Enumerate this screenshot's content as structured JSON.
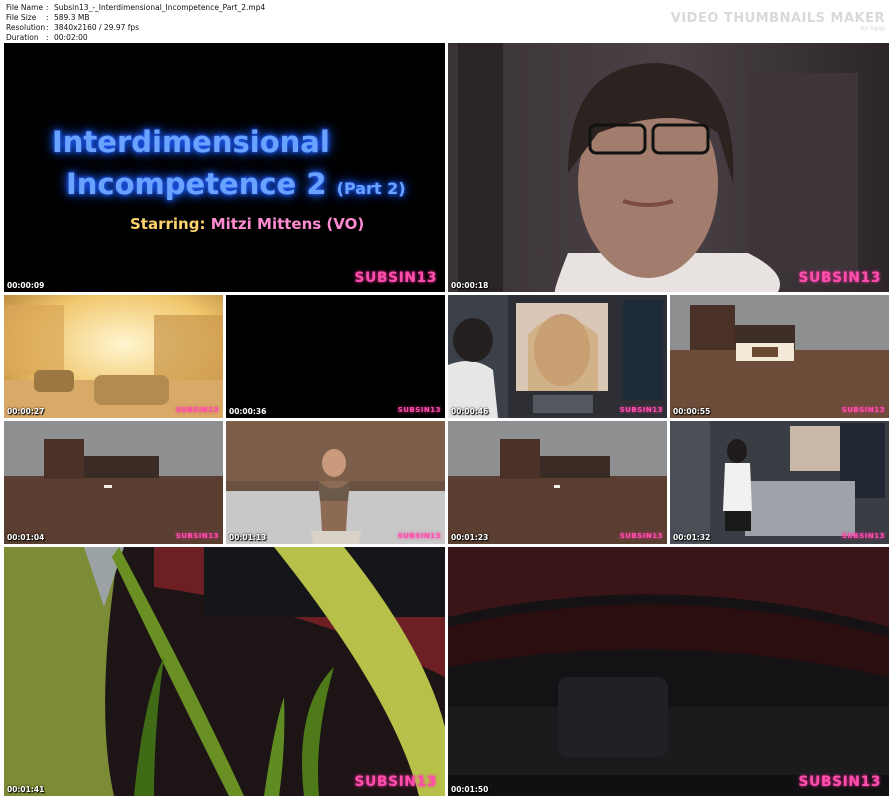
{
  "meta": {
    "rows": [
      {
        "key": "File Name",
        "value": "Subsin13_-_Interdimensional_Incompetence_Part_2.mp4"
      },
      {
        "key": "File Size",
        "value": "589.3 MB"
      },
      {
        "key": "Resolution",
        "value": "3840x2160 / 29.97 fps"
      },
      {
        "key": "Duration",
        "value": "00:02:00"
      }
    ]
  },
  "brand": {
    "title": "VIDEO THUMBNAILS MAKER",
    "subtitle": "by Sgap"
  },
  "title_card": {
    "line1": "Interdimensional",
    "line2": "Incompetence 2",
    "part": "(Part 2)",
    "starring_label": "Starring:",
    "starring_name": "Mitzi Mittens (VO)"
  },
  "watermark": "SUBSIN13",
  "timestamps": [
    "00:00:09",
    "00:00:18",
    "00:00:27",
    "00:00:36",
    "00:00:46",
    "00:00:55",
    "00:01:04",
    "00:01:13",
    "00:01:23",
    "00:01:32",
    "00:01:41",
    "00:01:50"
  ]
}
